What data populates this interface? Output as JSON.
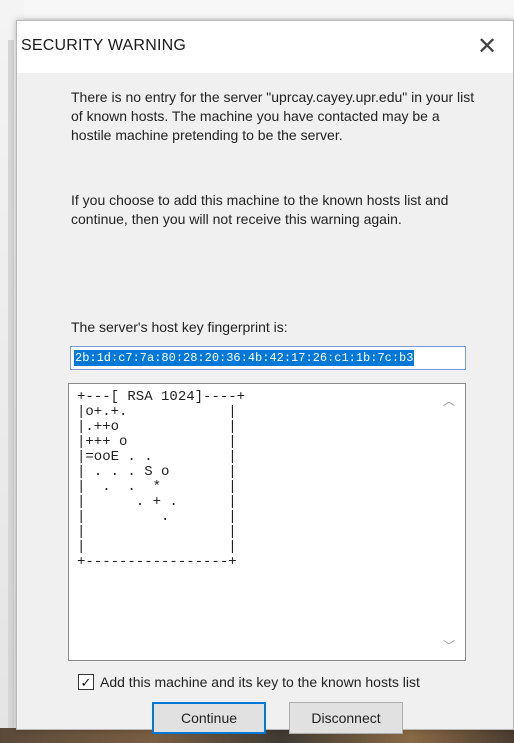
{
  "dialog": {
    "title": "SECURITY WARNING",
    "close_glyph": "✕",
    "message_1": "There is no entry for the server \"uprcay.cayey.upr.edu\" in your list of known hosts. The machine you have contacted may be a hostile machine pretending to be the server.",
    "message_2": "If you choose to add this machine to the known hosts list and continue, then you will not receive this warning again.",
    "fingerprint_label": "The server's host key fingerprint is:",
    "fingerprint_value": "2b:1d:c7:7a:80:28:20:36:4b:42:17:26:c1:1b:7c:b3",
    "randomart": "+---[ RSA 1024]----+\n|o+.+.            |\n|.++o             |\n|+++ o            |\n|=ooE . .         |\n| . . . S o       |\n|  .  .  *        |\n|      . + .      |\n|         .       |\n|                 |\n|                 |\n+-----------------+",
    "add_known_hosts_label": "Add this machine and its key to the known hosts list",
    "add_known_hosts_checked": true,
    "continue_label": "Continue",
    "disconnect_label": "Disconnect"
  },
  "icons": {
    "close": "close-icon",
    "checkmark": "checkmark-icon",
    "scroll_up": "scroll-up-arrow-icon",
    "scroll_down": "scroll-down-arrow-icon"
  },
  "colors": {
    "selection": "#0078d7",
    "default_button_border": "#0078d7"
  }
}
